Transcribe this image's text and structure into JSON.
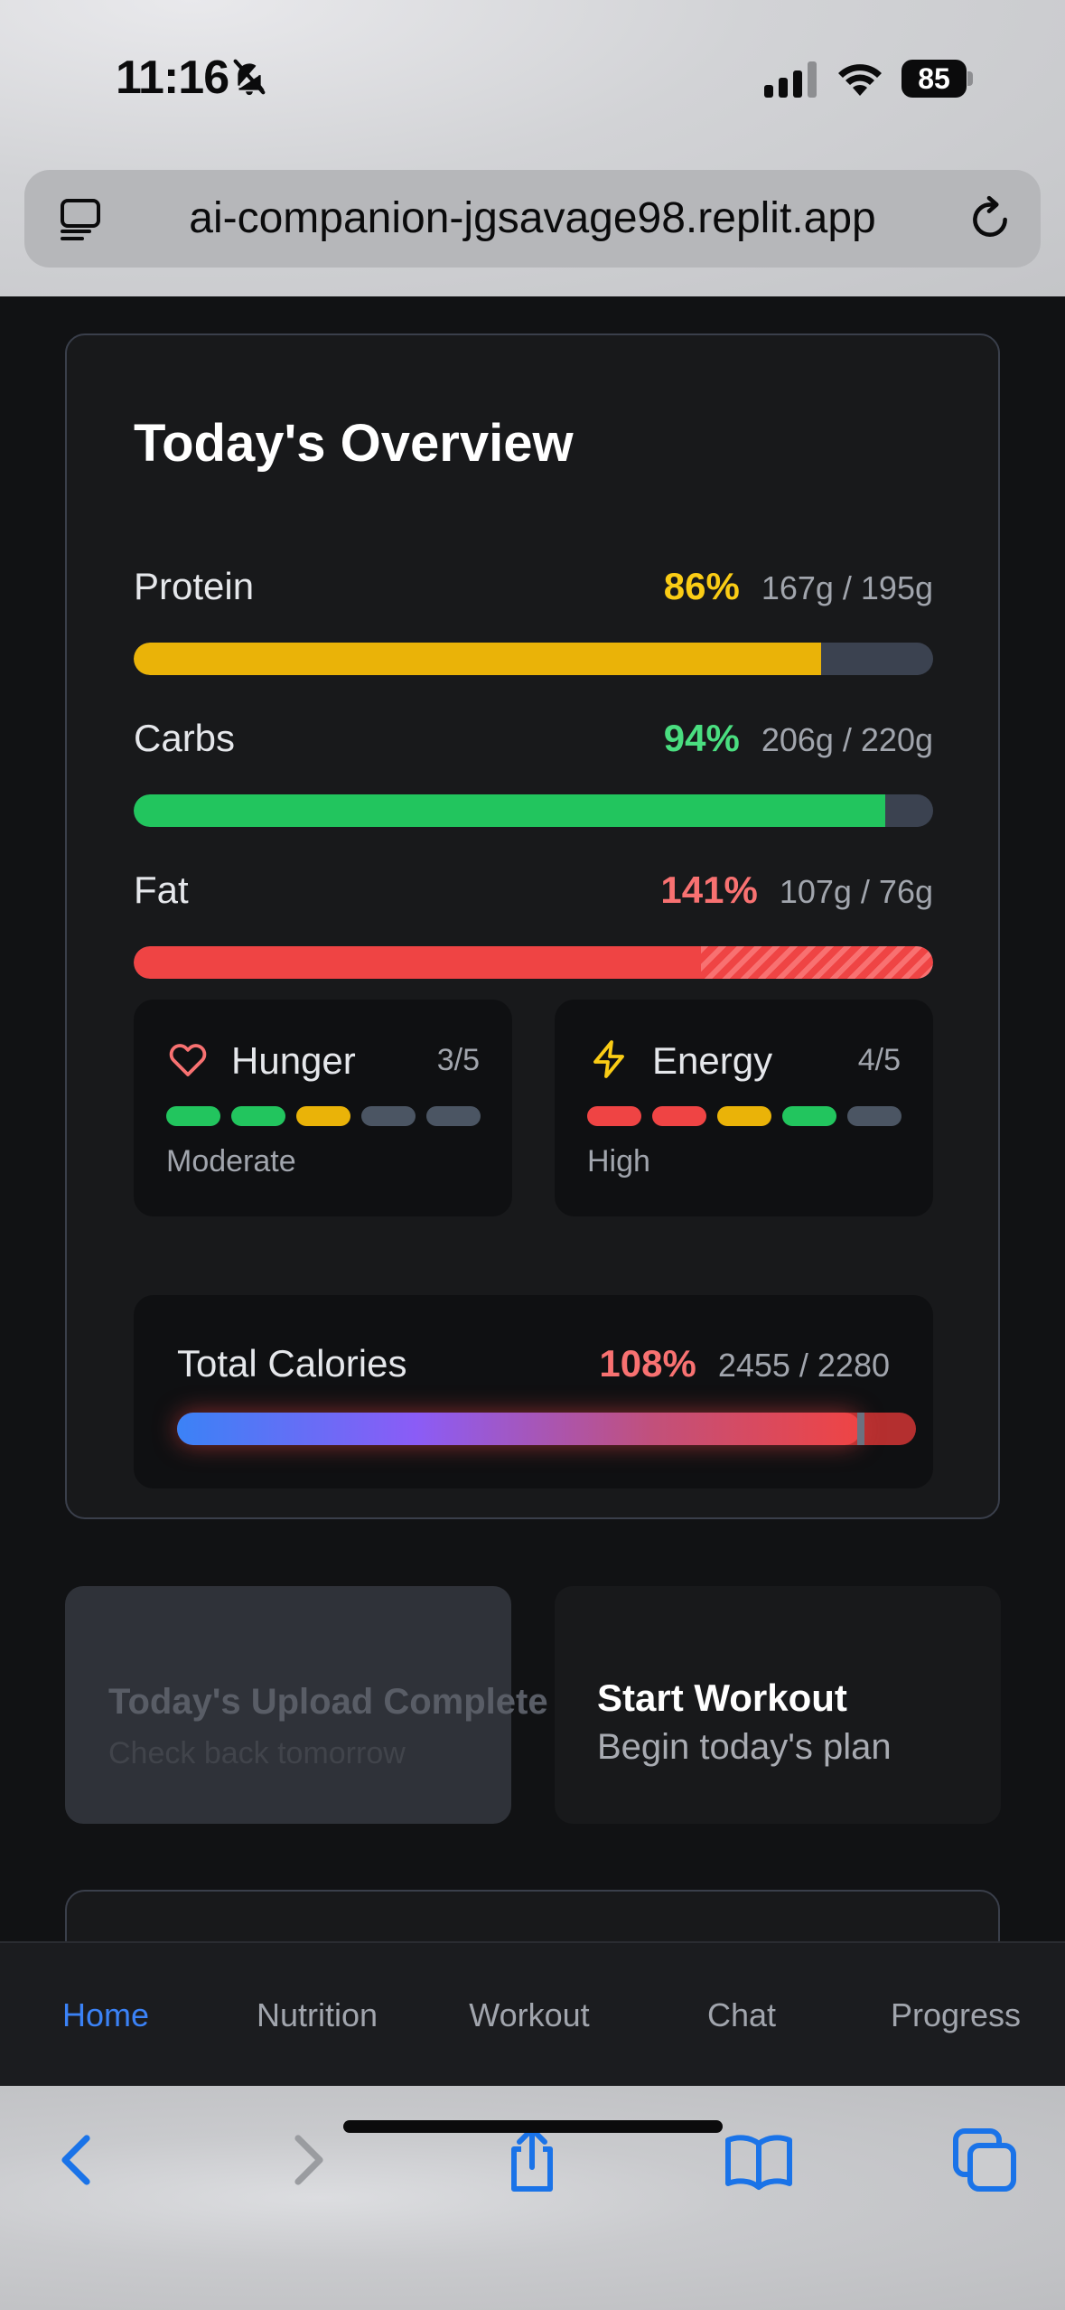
{
  "status_bar": {
    "time": "11:16",
    "battery": "85",
    "icons": [
      "bell-slash-icon",
      "cellular-signal-icon",
      "wifi-icon",
      "battery-icon"
    ]
  },
  "browser": {
    "url": "ai-companion-jgsavage98.replit.app",
    "icons": [
      "reader-icon",
      "reload-icon"
    ]
  },
  "overview": {
    "title": "Today's Overview",
    "macros": [
      {
        "label": "Protein",
        "percent": "86%",
        "amount": "167g / 195g",
        "fraction": 0.86,
        "color": "#eab308"
      },
      {
        "label": "Carbs",
        "percent": "94%",
        "amount": "206g / 220g",
        "fraction": 0.94,
        "color": "#22c55e"
      },
      {
        "label": "Fat",
        "percent": "141%",
        "amount": "107g / 76g",
        "fraction": 1.41,
        "color": "#ef4444"
      }
    ],
    "hunger": {
      "label": "Hunger",
      "score": "3/5",
      "level": 3,
      "description": "Moderate",
      "icon": "heart-icon",
      "pill_colors": [
        "#22c55e",
        "#22c55e",
        "#eab308",
        "#4b5563",
        "#4b5563"
      ]
    },
    "energy": {
      "label": "Energy",
      "score": "4/5",
      "level": 4,
      "description": "High",
      "icon": "lightning-icon",
      "pill_colors": [
        "#ef4444",
        "#ef4444",
        "#eab308",
        "#22c55e",
        "#4b5563"
      ]
    },
    "calories": {
      "label": "Total Calories",
      "percent": "108%",
      "amount": "2455 / 2280",
      "fraction": 1.08
    }
  },
  "actions": {
    "upload": {
      "title": "Today's Upload Complete",
      "subtitle": "Check back tomorrow"
    },
    "workout": {
      "title": "Start Workout",
      "subtitle": "Begin today's plan"
    }
  },
  "nav": {
    "items": [
      "Home",
      "Nutrition",
      "Workout",
      "Chat",
      "Progress"
    ],
    "active": "Home"
  },
  "toolbar": {
    "icons": [
      "back-icon",
      "forward-icon",
      "share-icon",
      "bookmarks-icon",
      "tabs-icon"
    ]
  },
  "colors": {
    "accent": "#3b82f6",
    "protein": "#eab308",
    "carbs": "#22c55e",
    "fat": "#ef4444",
    "calories_over": "#f87171"
  }
}
